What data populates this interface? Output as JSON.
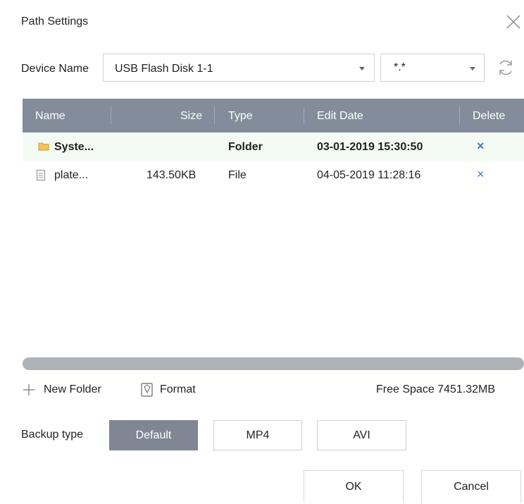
{
  "dialog": {
    "title": "Path Settings",
    "close_icon": "close-icon"
  },
  "device": {
    "label": "Device Name",
    "selected": "USB Flash Disk 1-1",
    "filter": "*.*",
    "refresh_icon": "refresh-icon"
  },
  "table": {
    "columns": {
      "name": "Name",
      "size": "Size",
      "type": "Type",
      "edit_date": "Edit Date",
      "delete": "Delete"
    },
    "rows": [
      {
        "icon": "folder-icon",
        "name": "Syste...",
        "size": "",
        "type": "Folder",
        "edit_date": "03-01-2019 15:30:50",
        "delete": "×"
      },
      {
        "icon": "file-icon",
        "name": "plate...",
        "size": "143.50KB",
        "type": "File",
        "edit_date": "04-05-2019 11:28:16",
        "delete": "×"
      }
    ]
  },
  "actions": {
    "new_folder": "New Folder",
    "format": "Format",
    "free_space": "Free Space 7451.32MB"
  },
  "backup": {
    "label": "Backup type",
    "options": [
      "Default",
      "MP4",
      "AVI"
    ],
    "selected": "Default"
  },
  "footer": {
    "ok": "OK",
    "cancel": "Cancel"
  },
  "colors": {
    "header_bg": "#828c9b",
    "selected_button_bg": "#7f8795",
    "delete_x": "#4a76c9",
    "selected_row_bg": "#f4fbf4"
  }
}
